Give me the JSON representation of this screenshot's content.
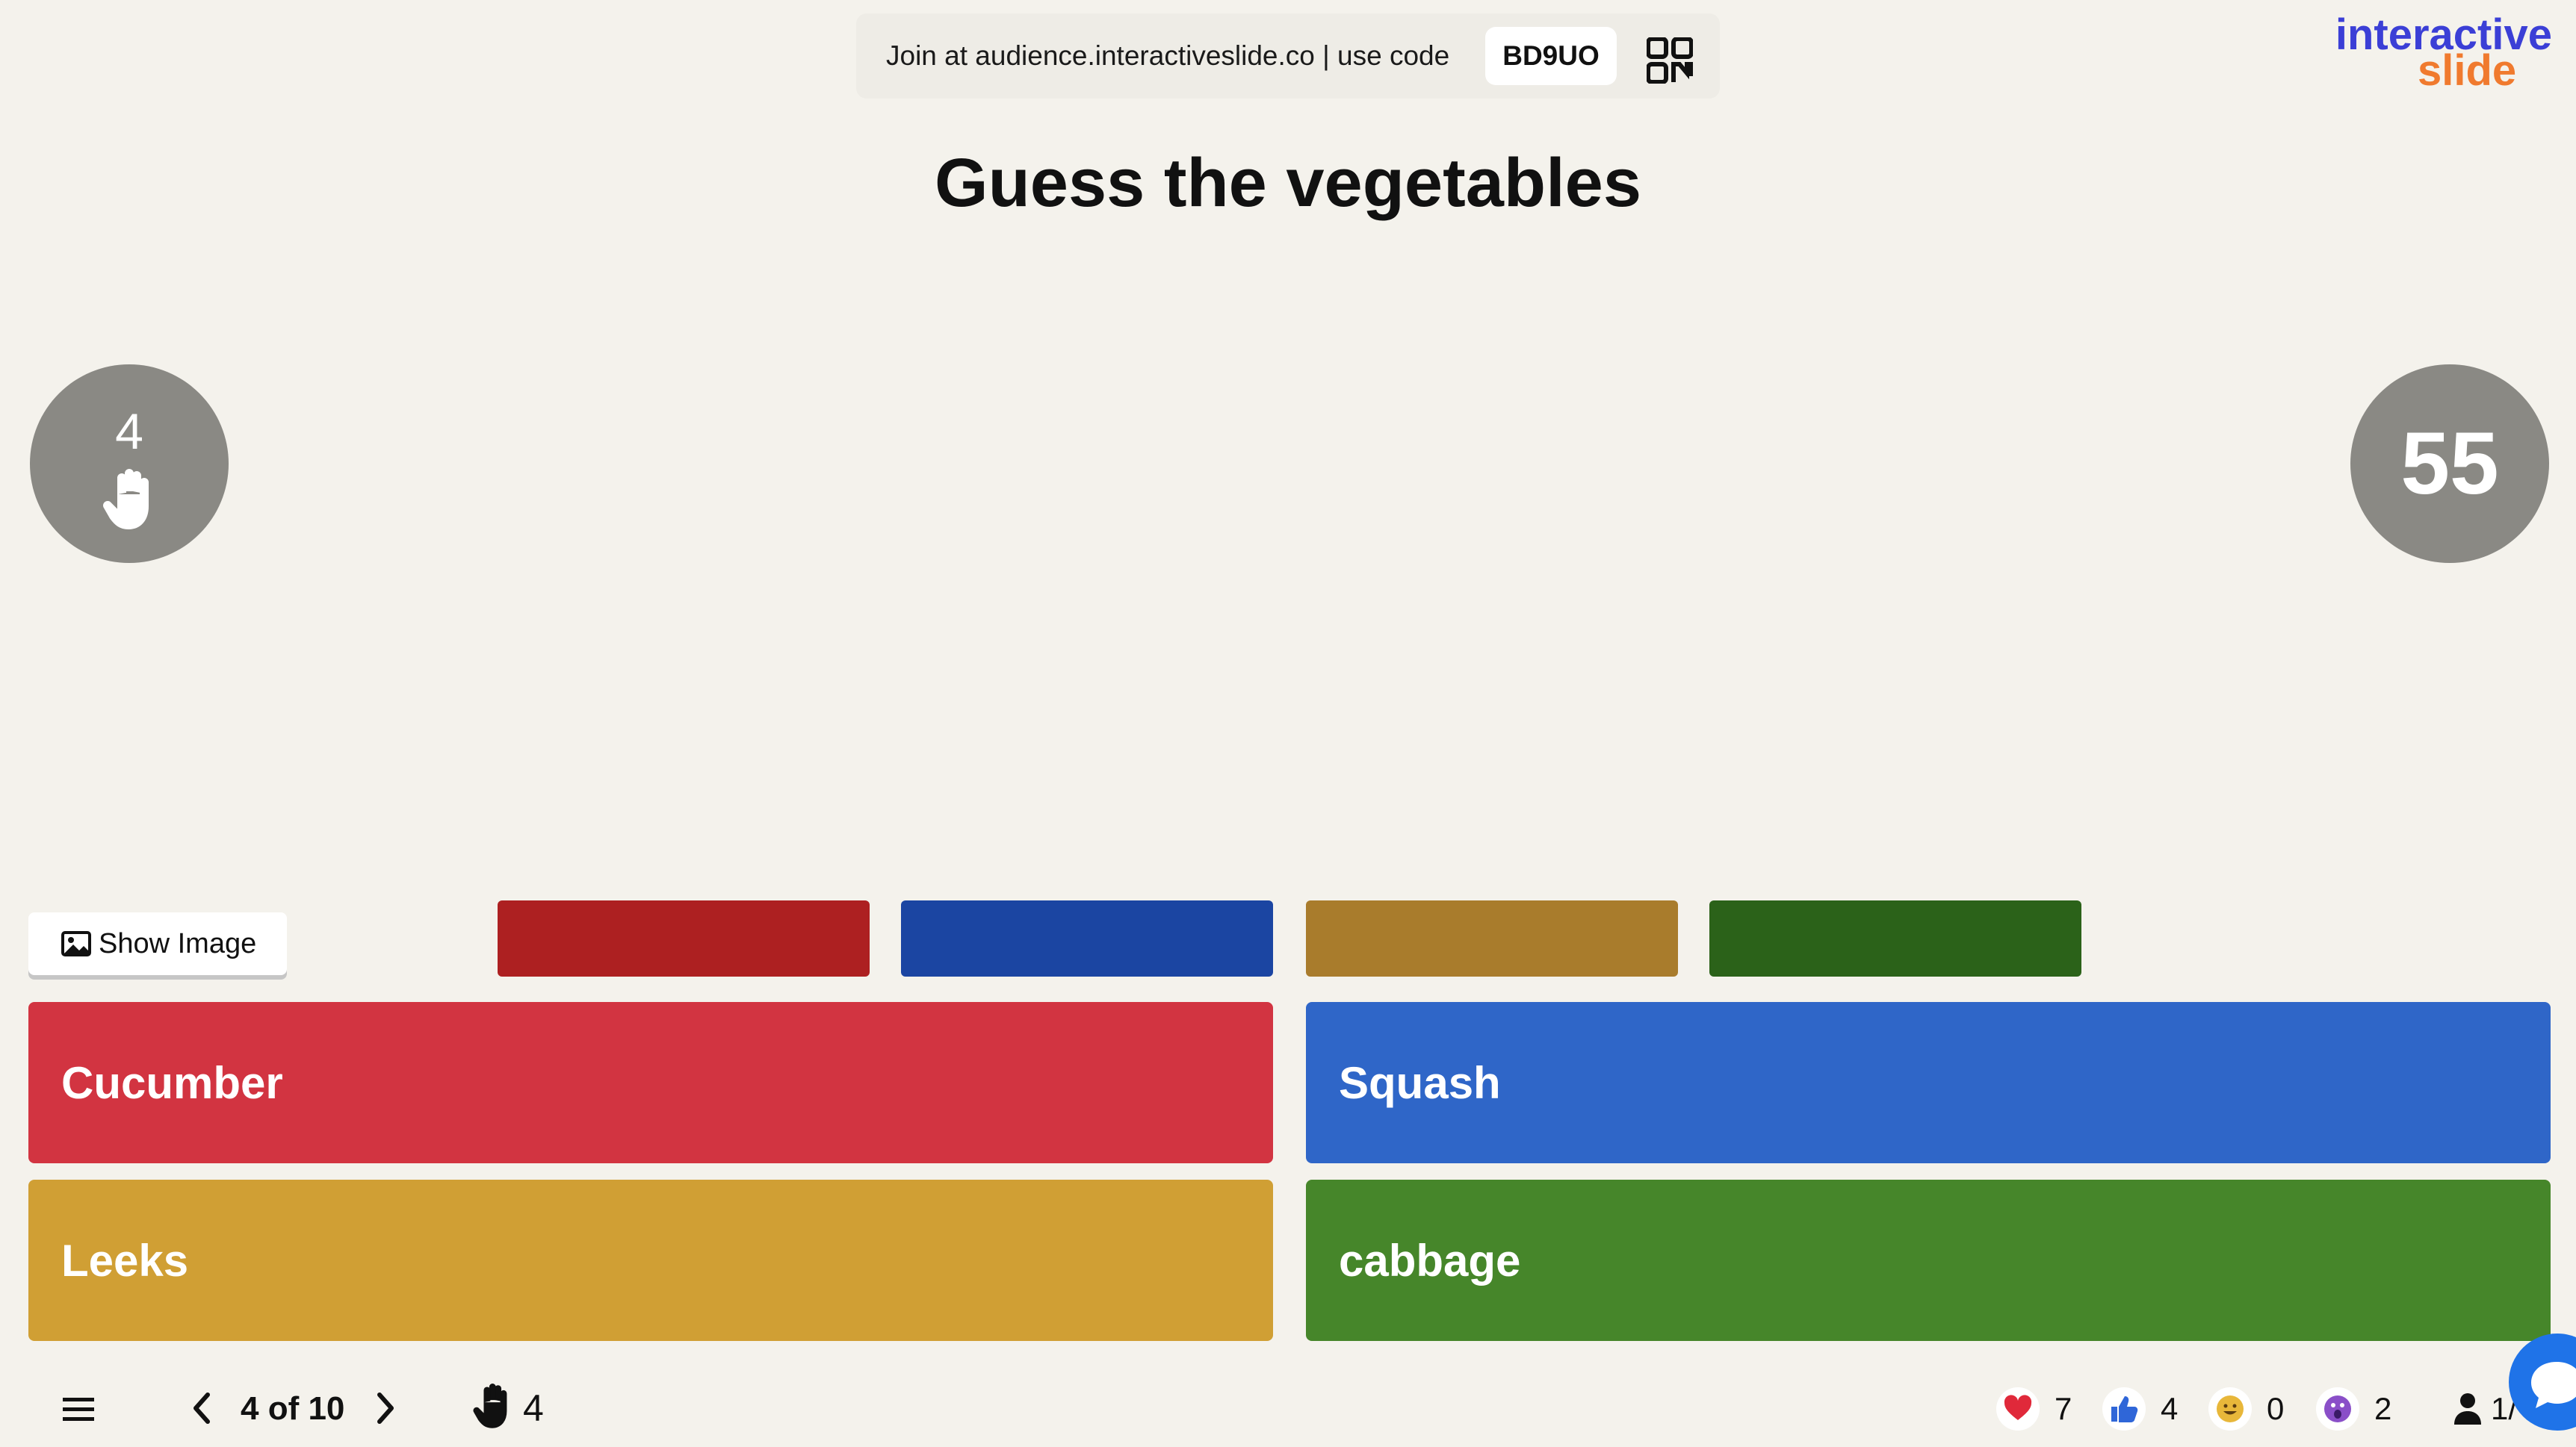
{
  "join": {
    "text": "Join at audience.interactiveslide.co | use code",
    "code": "BD9UO"
  },
  "logo": {
    "line1": "interactive",
    "line2": "slide"
  },
  "slide": {
    "title": "Guess the vegetables"
  },
  "left_circle": {
    "count": "4"
  },
  "right_circle": {
    "timer": "55"
  },
  "show_image_label": "Show Image",
  "answers": [
    {
      "label": "Cucumber",
      "color": "#d23441"
    },
    {
      "label": "Squash",
      "color": "#2f66c8"
    },
    {
      "label": "Leeks",
      "color": "#d09f34"
    },
    {
      "label": "cabbage",
      "color": "#46862a"
    }
  ],
  "result_bar_colors": [
    "#ad2021",
    "#1b45a2",
    "#a97c2c",
    "#2b6219"
  ],
  "navigation": {
    "counter": "4 of 10",
    "raised_hands": "4"
  },
  "reactions": {
    "heart": "7",
    "thumbs_up": "4",
    "smile": "0",
    "wow": "2"
  },
  "participants": "1/",
  "colors": {
    "background": "#f4f2ec",
    "circle": "#8a8984",
    "logo_blue": "#3b3fd6",
    "logo_orange": "#f07a2e"
  }
}
